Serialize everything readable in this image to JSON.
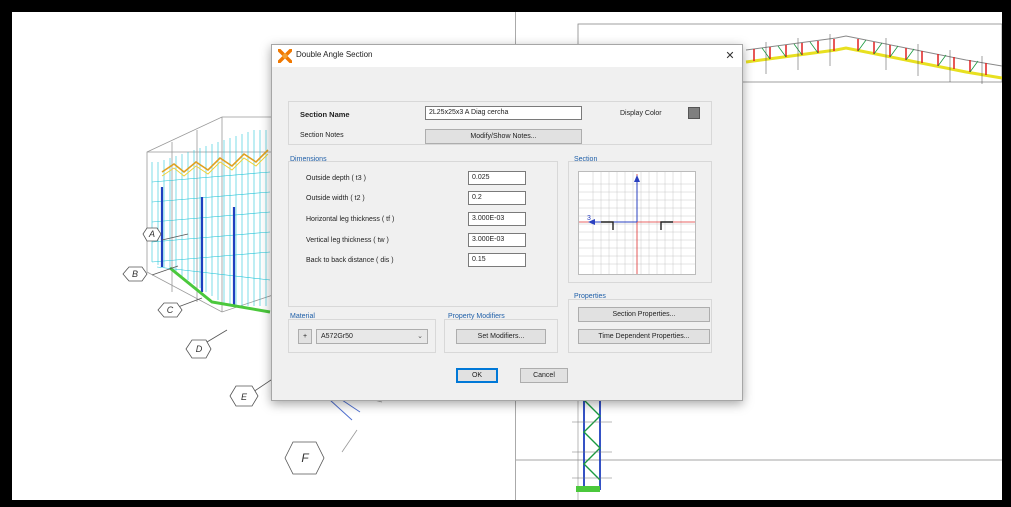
{
  "dialog": {
    "title": "Double Angle Section",
    "close_glyph": "✕",
    "section_name_label": "Section Name",
    "section_name_value": "2L25x25x3 A Diag cercha",
    "display_color_label": "Display Color",
    "display_color": "#7f7f7f",
    "section_notes_label": "Section Notes",
    "modify_notes_button": "Modify/Show Notes...",
    "dimensions": {
      "title": "Dimensions",
      "rows": [
        {
          "label": "Outside depth  ( t3 )",
          "value": "0.025"
        },
        {
          "label": "Outside width  ( t2 )",
          "value": "0.2"
        },
        {
          "label": "Horizontal leg thickness  ( tf )",
          "value": "3.000E-03"
        },
        {
          "label": "Vertical leg thickness  ( tw )",
          "value": "3.000E-03"
        },
        {
          "label": "Back to back distance  ( dis )",
          "value": "0.15"
        }
      ]
    },
    "section_group_title": "Section",
    "section_axis_label": "3",
    "properties": {
      "title": "Properties",
      "section_properties_button": "Section Properties...",
      "time_dependent_button": "Time Dependent Properties..."
    },
    "material": {
      "title": "Material",
      "plus_label": "+",
      "selected": "A572Gr50"
    },
    "property_modifiers": {
      "title": "Property Modifiers",
      "set_modifiers_button": "Set Modifiers..."
    },
    "ok_button": "OK",
    "cancel_button": "Cancel"
  },
  "grid_labels": [
    "A",
    "B",
    "C",
    "D",
    "E",
    "F"
  ]
}
